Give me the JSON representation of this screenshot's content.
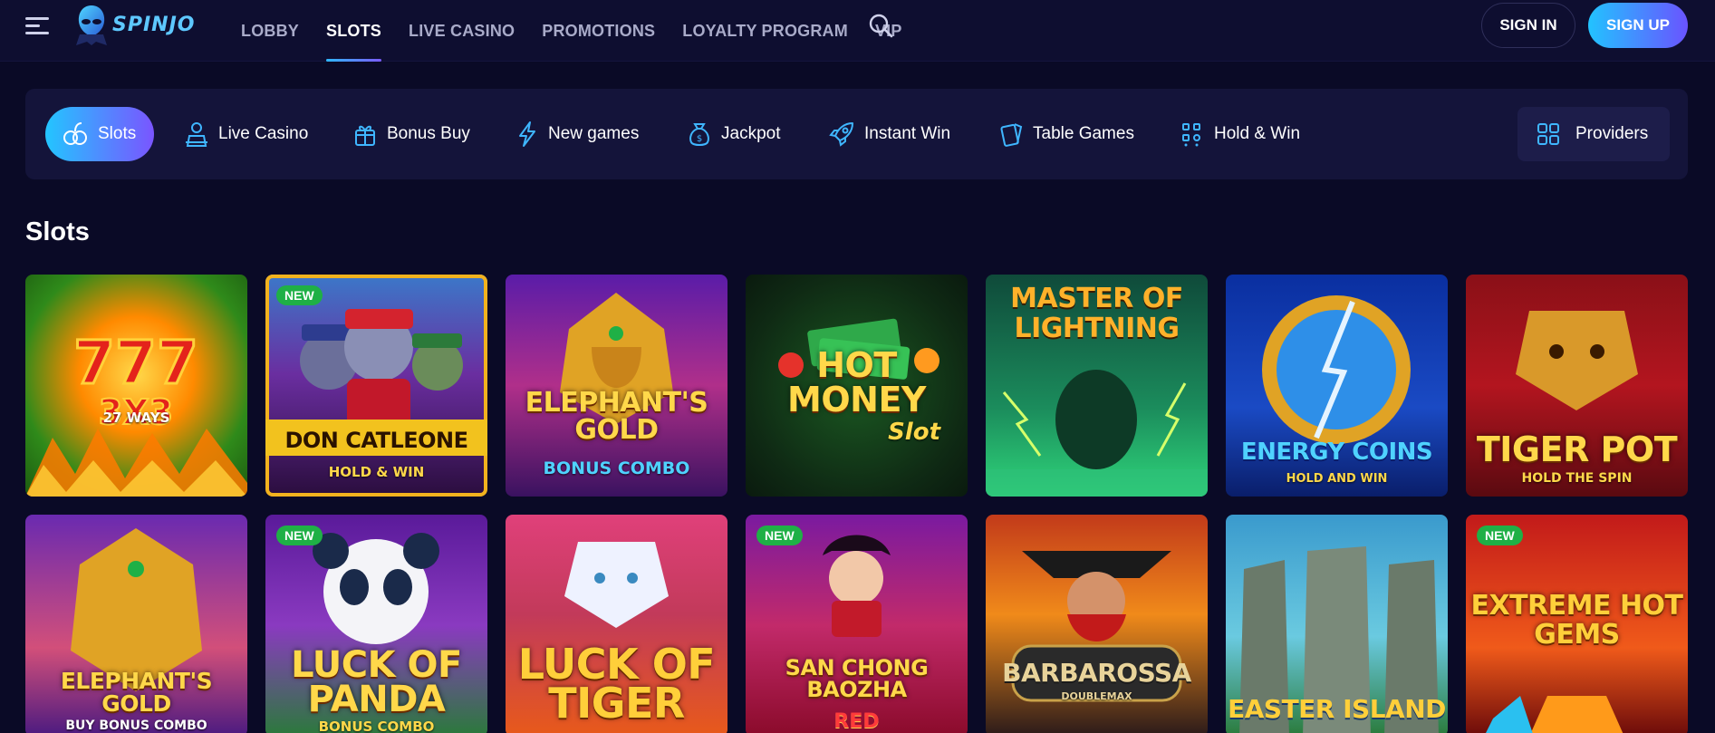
{
  "header": {
    "logo_text": "SPINJO",
    "nav": [
      "LOBBY",
      "SLOTS",
      "LIVE CASINO",
      "PROMOTIONS",
      "LOYALTY PROGRAM",
      "VIP"
    ],
    "active_nav": "SLOTS",
    "sign_in": "SIGN IN",
    "sign_up": "SIGN UP"
  },
  "categories": {
    "items": [
      {
        "label": "Slots",
        "icon": "slots-icon",
        "active": true
      },
      {
        "label": "Live Casino",
        "icon": "dealer-icon"
      },
      {
        "label": "Bonus Buy",
        "icon": "gift-icon"
      },
      {
        "label": "New games",
        "icon": "lightning-icon"
      },
      {
        "label": "Jackpot",
        "icon": "money-bag-icon"
      },
      {
        "label": "Instant Win",
        "icon": "rocket-icon"
      },
      {
        "label": "Table Games",
        "icon": "cards-icon"
      },
      {
        "label": "Hold & Win",
        "icon": "grid-dots-icon"
      }
    ],
    "providers": "Providers"
  },
  "section": {
    "title": "Slots"
  },
  "games": [
    {
      "title": "777",
      "sub": "27 WAYS",
      "new": false
    },
    {
      "title": "DON CATLEONE",
      "sub": "HOLD & WIN",
      "new": true,
      "badge": "NEW"
    },
    {
      "title": "ELEPHANT'S GOLD",
      "sub": "BONUS COMBO",
      "new": false
    },
    {
      "title": "HOT MONEY",
      "sub": "Slot",
      "new": false
    },
    {
      "title": "MASTER OF LIGHTNING",
      "sub": "",
      "new": false
    },
    {
      "title": "ENERGY COINS",
      "sub": "HOLD AND WIN",
      "new": false
    },
    {
      "title": "TIGER POT",
      "sub": "HOLD THE SPIN",
      "new": false
    },
    {
      "title": "ELEPHANT'S GOLD",
      "sub": "BUY BONUS COMBO",
      "new": false
    },
    {
      "title": "LUCK OF PANDA",
      "sub": "BONUS COMBO",
      "new": true,
      "badge": "NEW"
    },
    {
      "title": "LUCK OF TIGER",
      "sub": "",
      "new": false
    },
    {
      "title": "SAN CHONG BAOZHA",
      "sub": "RED",
      "new": true,
      "badge": "NEW"
    },
    {
      "title": "BARBAROSSA",
      "sub": "DOUBLEMAX",
      "new": false
    },
    {
      "title": "EASTER ISLAND",
      "sub": "",
      "new": false
    },
    {
      "title": "EXTREME HOT GEMS",
      "sub": "",
      "new": true,
      "badge": "NEW"
    }
  ]
}
